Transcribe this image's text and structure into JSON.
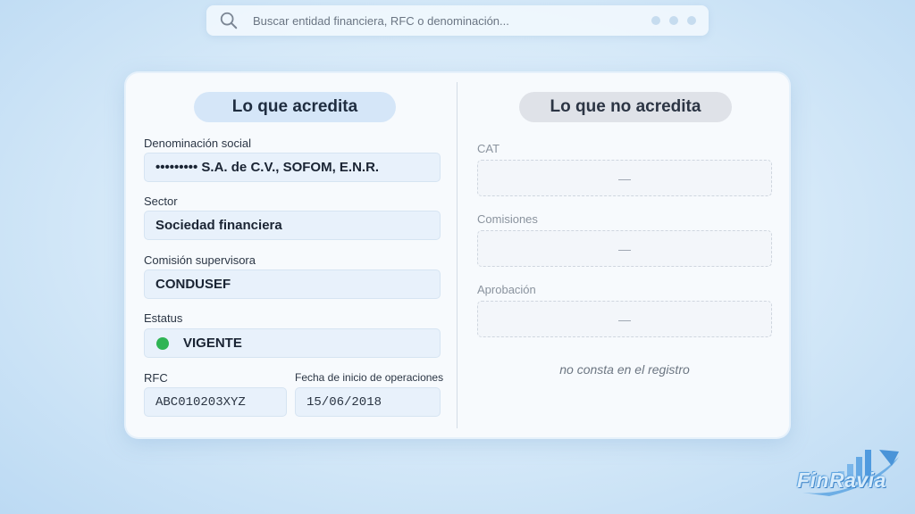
{
  "search": {
    "placeholder": "Buscar entidad financiera, RFC o denominación..."
  },
  "card": {
    "left_title": "Lo que acredita",
    "right_title": "Lo que no acredita",
    "fields": {
      "denominacion": {
        "label": "Denominación social",
        "value": "••••••••• S.A. de C.V., SOFOM, E.N.R."
      },
      "sector": {
        "label": "Sector",
        "value": "Sociedad financiera"
      },
      "comision": {
        "label": "Comisión supervisora",
        "value": "CONDUSEF"
      },
      "estatus": {
        "label": "Estatus",
        "value": "VIGENTE",
        "color": "#2fb454"
      },
      "rfc": {
        "label": "RFC",
        "value": "ABC010203XYZ"
      },
      "fecha": {
        "label": "Fecha de inicio de operaciones",
        "value": "15/06/2018"
      }
    },
    "not_accredited": [
      {
        "label": "CAT",
        "value": "—"
      },
      {
        "label": "Comisiones",
        "value": "—"
      },
      {
        "label": "Aprobación",
        "value": "—"
      }
    ],
    "note": "no consta en el registro"
  },
  "brand": {
    "logo_text": "FinRavia"
  }
}
